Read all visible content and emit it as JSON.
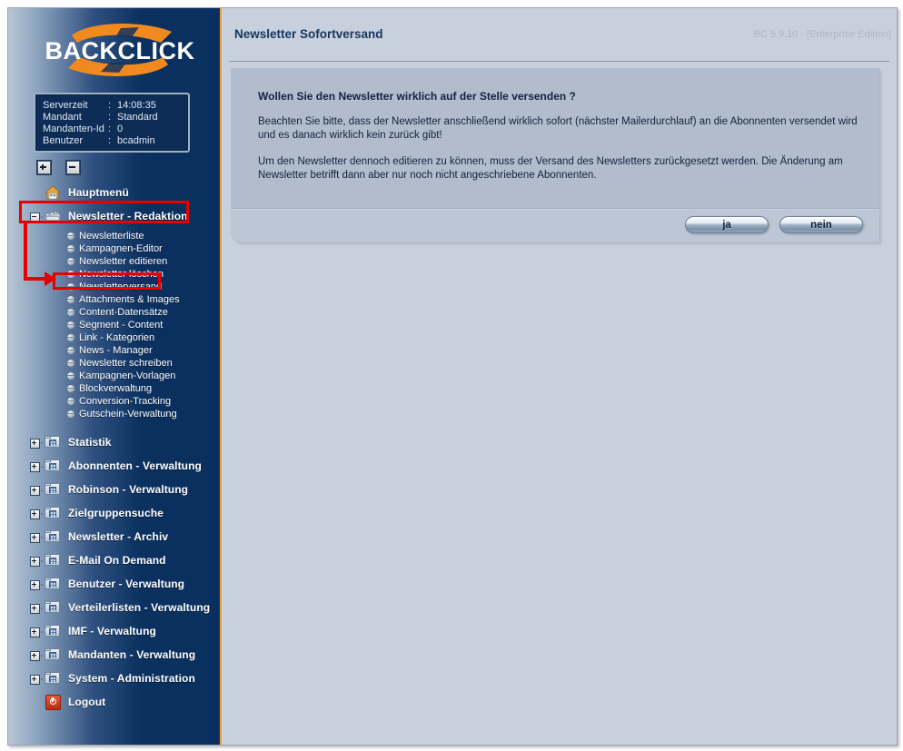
{
  "app": {
    "logo_text": "BACKCLICK",
    "version_label": "BC 5.9.10 - [Enterprise Edition]"
  },
  "sidebar": {
    "info": {
      "rows": [
        {
          "key": "Serverzeit",
          "sep": ":",
          "value": "14:08:35"
        },
        {
          "key": "Mandant",
          "sep": ":",
          "value": "Standard"
        },
        {
          "key": "Mandanten-Id",
          "sep": ":",
          "value": "0"
        },
        {
          "key": "Benutzer",
          "sep": ":",
          "value": "bcadmin"
        }
      ]
    },
    "tree_controls": {
      "expand_all": "expand-all",
      "collapse_all": "collapse-all"
    },
    "items": [
      {
        "label": "Hauptmenü",
        "icon": "house-icon",
        "toggle": "none"
      },
      {
        "label": "Newsletter - Redaktion",
        "icon": "clapper-icon",
        "toggle": "minus"
      },
      {
        "label": "Statistik",
        "icon": "folder-icon",
        "toggle": "plus"
      },
      {
        "label": "Abonnenten - Verwaltung",
        "icon": "folder-icon",
        "toggle": "plus"
      },
      {
        "label": "Robinson - Verwaltung",
        "icon": "folder-icon",
        "toggle": "plus"
      },
      {
        "label": "Zielgruppensuche",
        "icon": "folder-icon",
        "toggle": "plus"
      },
      {
        "label": "Newsletter - Archiv",
        "icon": "folder-icon",
        "toggle": "plus"
      },
      {
        "label": "E-Mail On Demand",
        "icon": "folder-icon",
        "toggle": "plus"
      },
      {
        "label": "Benutzer - Verwaltung",
        "icon": "folder-icon",
        "toggle": "plus"
      },
      {
        "label": "Verteilerlisten - Verwaltung",
        "icon": "folder-icon",
        "toggle": "plus"
      },
      {
        "label": "IMF - Verwaltung",
        "icon": "folder-icon",
        "toggle": "plus"
      },
      {
        "label": "Mandanten - Verwaltung",
        "icon": "folder-icon",
        "toggle": "plus"
      },
      {
        "label": "System - Administration",
        "icon": "folder-icon",
        "toggle": "plus"
      },
      {
        "label": "Logout",
        "icon": "power-icon",
        "toggle": "none"
      }
    ],
    "submenu": [
      {
        "label": "Newsletterliste"
      },
      {
        "label": "Kampagnen-Editor"
      },
      {
        "label": "Newsletter editieren"
      },
      {
        "label": "Newsletter löschen"
      },
      {
        "label": "Newsletterversand"
      },
      {
        "label": "Attachments & Images"
      },
      {
        "label": "Content-Datensätze"
      },
      {
        "label": "Segment - Content"
      },
      {
        "label": "Link - Kategorien"
      },
      {
        "label": "News - Manager"
      },
      {
        "label": "Newsletter schreiben"
      },
      {
        "label": "Kampagnen-Vorlagen"
      },
      {
        "label": "Blockverwaltung"
      },
      {
        "label": "Conversion-Tracking"
      },
      {
        "label": "Gutschein-Verwaltung"
      }
    ]
  },
  "main": {
    "title": "Newsletter Sofortversand",
    "question": "Wollen Sie den Newsletter wirklich auf der Stelle versenden ?",
    "paragraph1": "Beachten Sie bitte, dass der Newsletter anschließend wirklich sofort (nächster Mailerdurchlauf) an die Abonnenten versendet wird und es danach wirklich kein zurück gibt!",
    "paragraph2": "Um den Newsletter dennoch editieren zu können, muss der Versand des Newsletters zurückgesetzt werden. Die Änderung am Newsletter betrifft dann aber nur noch nicht angeschriebene Abonnenten.",
    "buttons": {
      "yes": "ja",
      "no": "nein"
    }
  },
  "colors": {
    "accent_orange": "#e8a33d",
    "sidebar_dark": "#0a2f5e",
    "panel": "#b1bdcd",
    "content_bg": "#c7d0dc",
    "annotation_red": "#e60000",
    "title_blue": "#16355f"
  }
}
